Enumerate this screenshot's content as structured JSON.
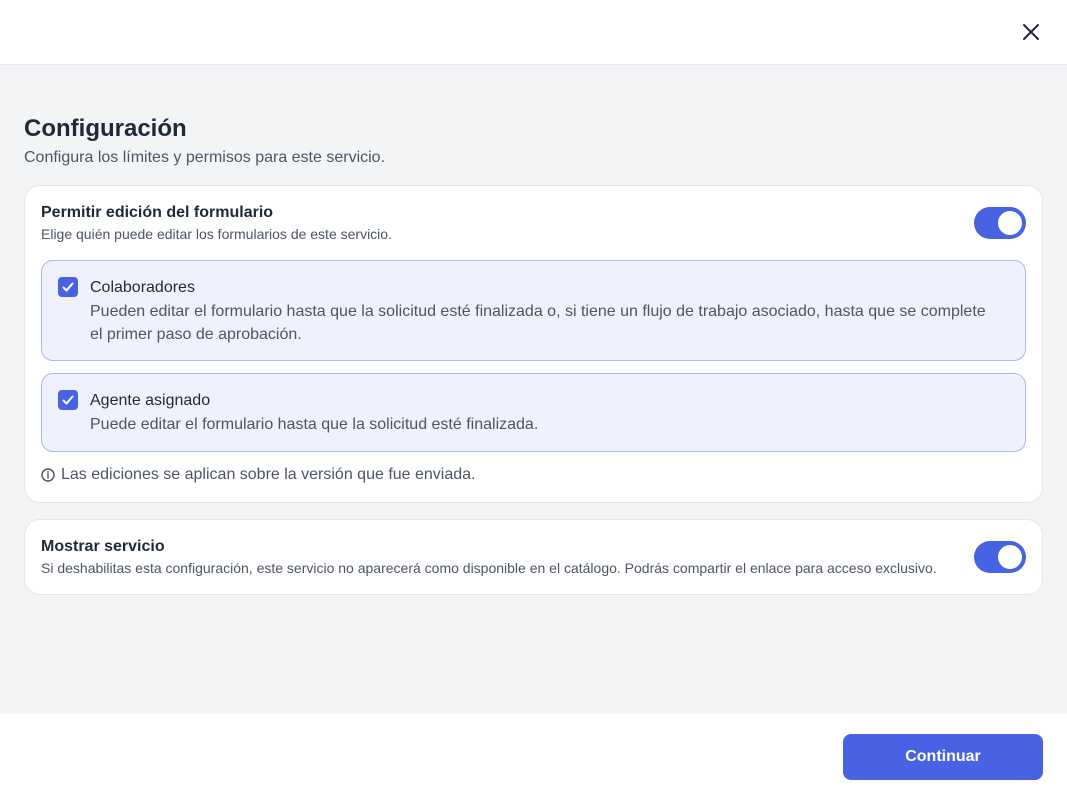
{
  "header": {
    "close_icon": "close-icon"
  },
  "main": {
    "title": "Configuración",
    "subtitle": "Configura los límites y permisos para este servicio."
  },
  "edit_card": {
    "title": "Permitir edición del formulario",
    "description": "Elige quién puede editar los formularios de este servicio.",
    "toggle_on": true,
    "options": [
      {
        "label": "Colaboradores",
        "description": "Pueden editar el formulario hasta que la solicitud esté finalizada o, si tiene un flujo de trabajo asociado, hasta que se complete el primer paso de aprobación.",
        "checked": true
      },
      {
        "label": "Agente asignado",
        "description": "Puede editar el formulario hasta que la solicitud esté finalizada.",
        "checked": true
      }
    ],
    "info_text": "Las ediciones se aplican sobre la versión que fue enviada.",
    "info_icon": "info-icon"
  },
  "show_card": {
    "title": "Mostrar servicio",
    "description": "Si deshabilitas esta configuración, este servicio no aparecerá como disponible en el catálogo. Podrás compartir el enlace para acceso exclusivo.",
    "toggle_on": true
  },
  "footer": {
    "continue_label": "Continuar"
  },
  "colors": {
    "accent": "#4763e4",
    "option_bg": "#eff2fc",
    "option_border": "#a9b9e8",
    "page_bg": "#f3f4f6"
  }
}
